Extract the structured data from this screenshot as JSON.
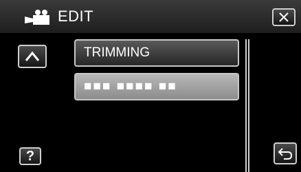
{
  "header": {
    "mode_icon": "movie-camera-icon",
    "title": "EDIT",
    "close_icon": "close-x-icon"
  },
  "list": {
    "items": [
      {
        "label": "TRIMMING"
      },
      {
        "label": "■■■ ■■■■ ■■"
      }
    ]
  },
  "nav": {
    "up_icon": "chevron-up-icon",
    "back_icon": "return-arrow-icon"
  },
  "help": {
    "label": "?"
  }
}
